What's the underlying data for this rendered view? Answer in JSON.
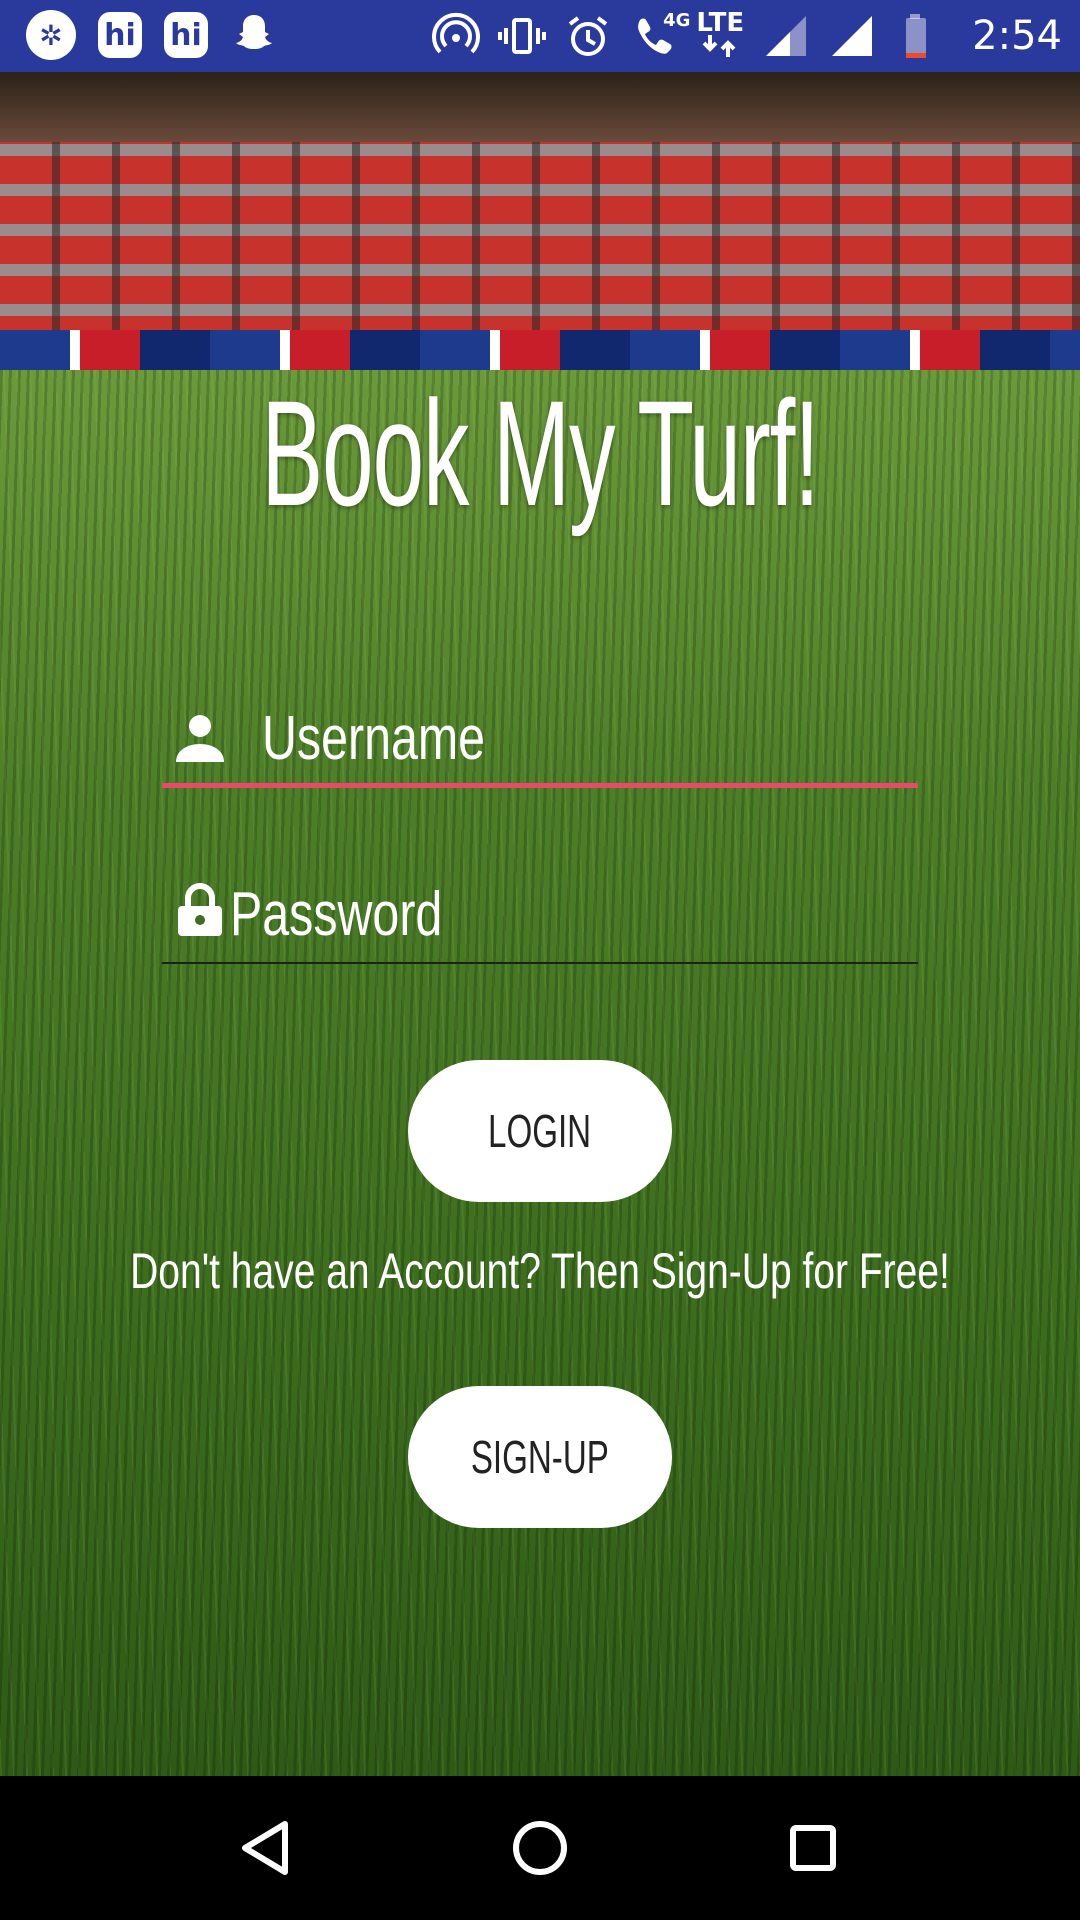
{
  "status_bar": {
    "time": "2:54",
    "network_label_top": "4G",
    "network_label_lte": "LTE",
    "app_icons": [
      {
        "name": "browser-app-icon",
        "glyph": "✲"
      },
      {
        "name": "hike-app-icon",
        "glyph": "hi"
      },
      {
        "name": "hike-app-icon",
        "glyph": "hi"
      },
      {
        "name": "snapchat-app-icon",
        "glyph": "👻"
      }
    ],
    "bg_color": "#2a3a9c"
  },
  "app": {
    "title": "Book My Turf!"
  },
  "login_form": {
    "username": {
      "value": "",
      "placeholder": "Username",
      "icon": "person-icon",
      "focused": true
    },
    "password": {
      "value": "",
      "placeholder": "Password",
      "icon": "lock-icon",
      "focused": false
    },
    "login_label": "LOGIN",
    "signup_prompt": "Don't have an Account? Then Sign-Up for Free!",
    "signup_label": "SIGN-UP"
  },
  "colors": {
    "focus_underline": "#e84a6a",
    "button_bg": "#ffffff",
    "text": "#ffffff"
  },
  "nav_bar": {
    "buttons": [
      "back-icon",
      "home-icon",
      "recents-icon"
    ]
  }
}
